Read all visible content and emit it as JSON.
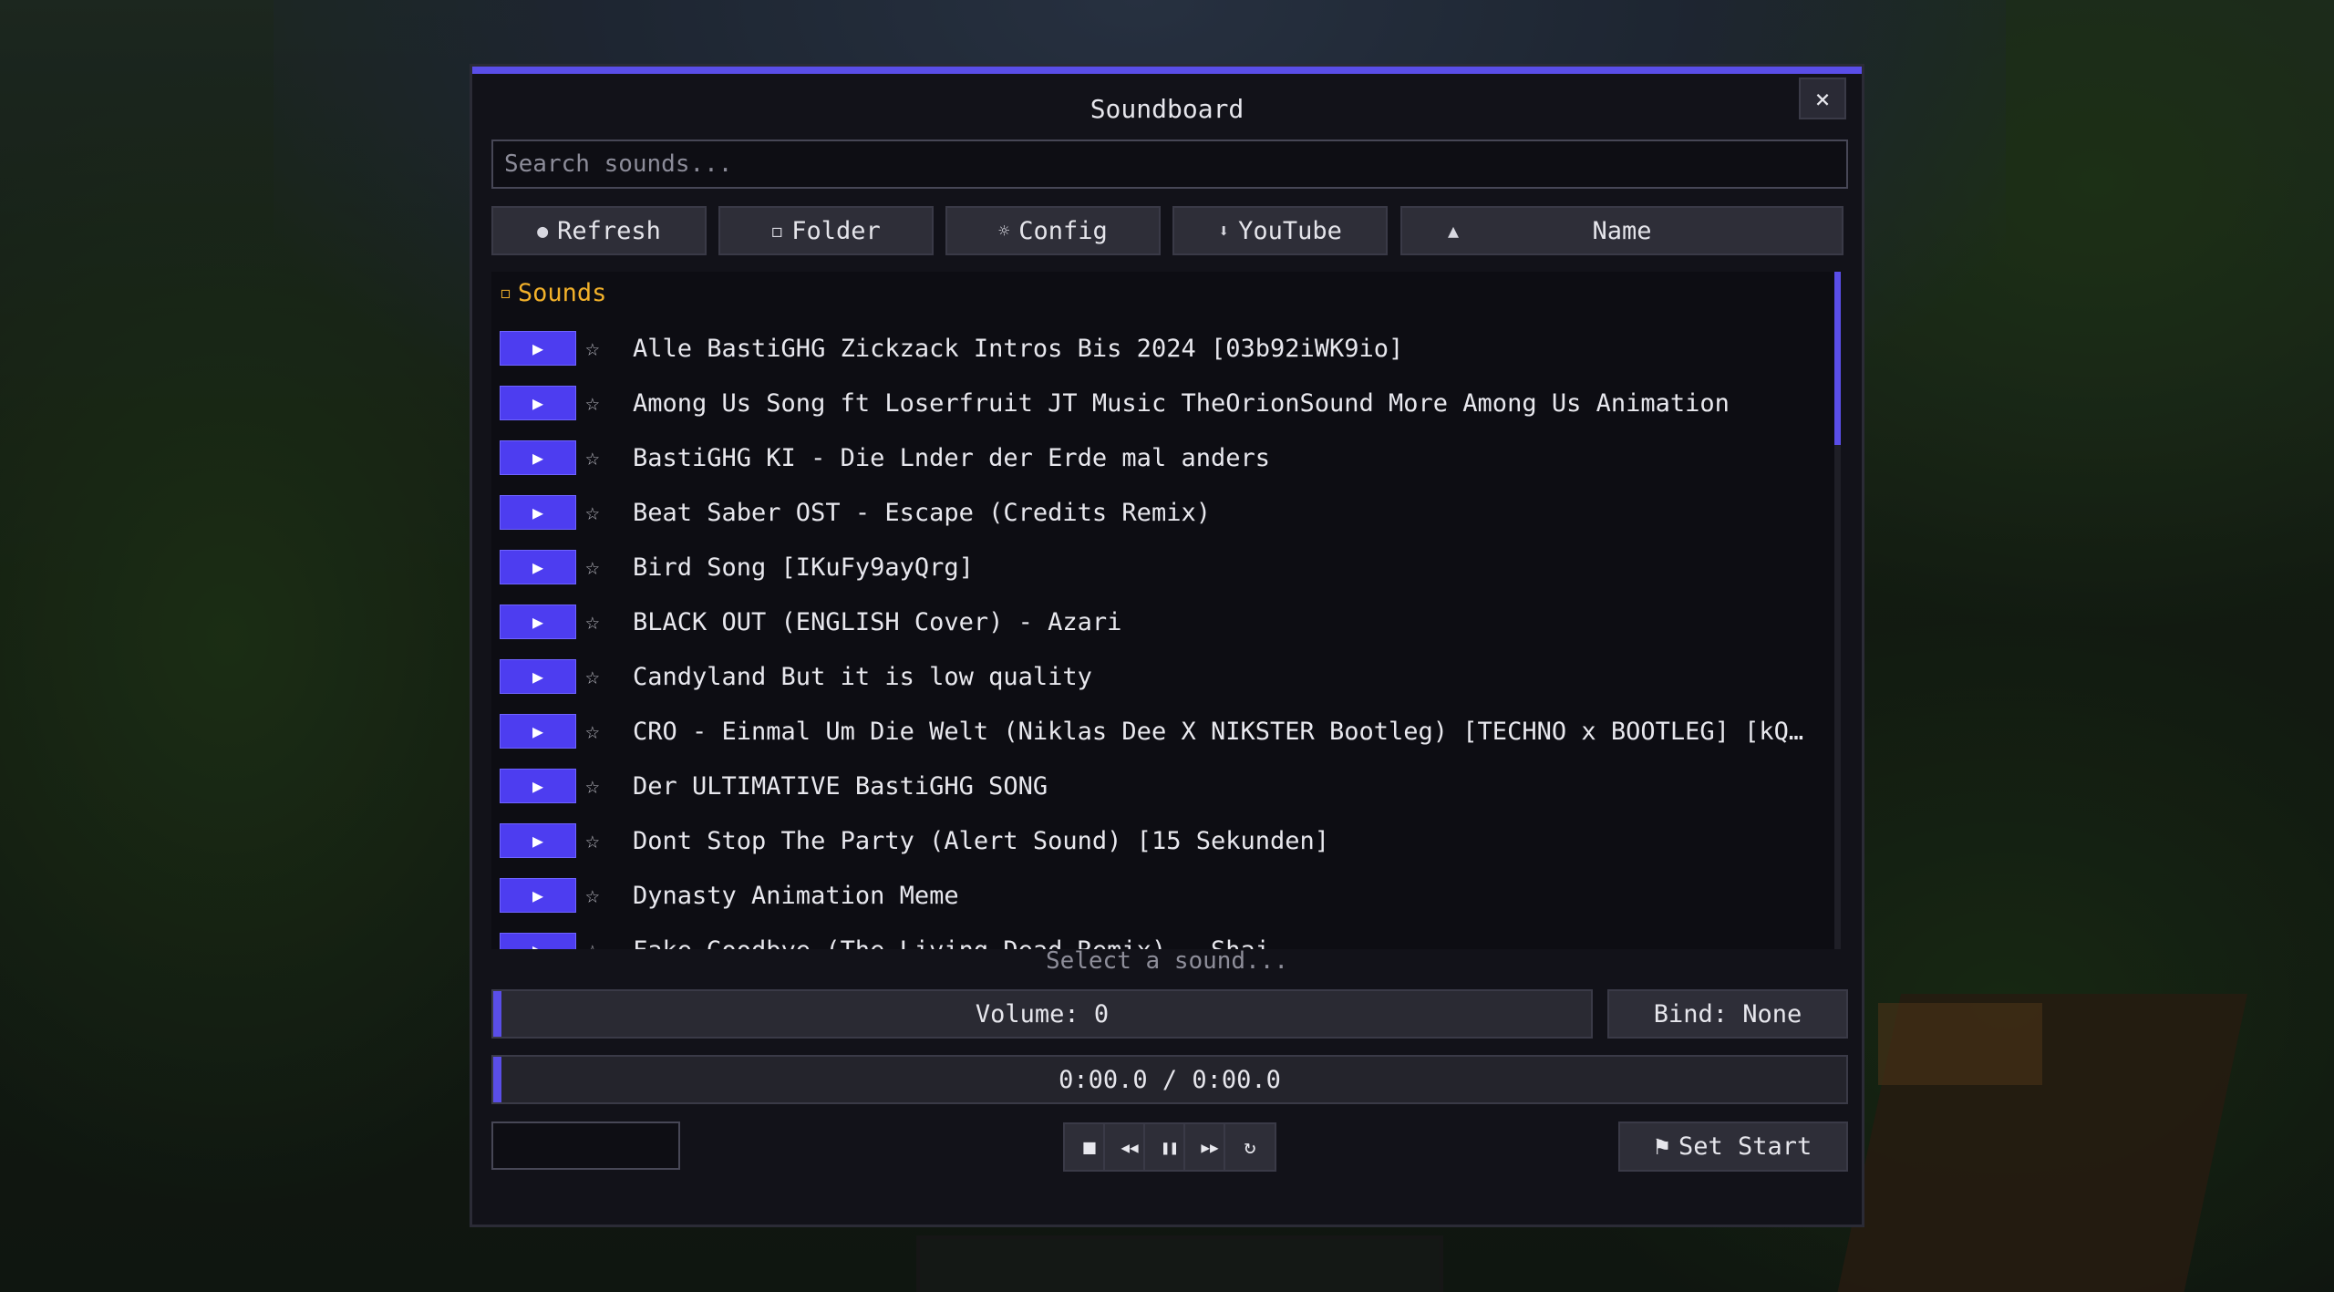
{
  "window": {
    "title": "Soundboard",
    "close_icon": "×"
  },
  "search": {
    "placeholder": "Search sounds..."
  },
  "toolbar": {
    "refresh": {
      "icon": "●",
      "label": "Refresh"
    },
    "folder": {
      "icon": "◻",
      "label": "Folder"
    },
    "config": {
      "icon": "☼",
      "label": "Config"
    },
    "youtube": {
      "icon": "⬇",
      "label": "YouTube"
    },
    "sort": {
      "icon": "▲",
      "label": "Name"
    }
  },
  "list": {
    "folder_label": "Sounds",
    "folder_icon": "◻",
    "play_icon": "▶",
    "star_icon": "☆",
    "items": [
      "Alle BastiGHG Zickzack Intros Bis 2024 [03b92iWK9io]",
      "Among Us Song ft Loserfruit JT Music TheOrionSound More Among Us Animation",
      "BastiGHG KI - Die Lnder der Erde mal anders",
      "Beat Saber OST - Escape (Credits Remix)",
      "Bird Song [IKuFy9ayQrg]",
      "BLACK OUT (ENGLISH Cover) - Azari",
      "Candyland But it is low quality",
      "CRO - Einmal Um Die Welt (Niklas Dee X NIKSTER Bootleg) [TECHNO x BOOTLEG] [kQdJrLV...",
      "Der ULTIMATIVE BastiGHG SONG",
      "Dont Stop The Party (Alert Sound) [15 Sekunden]",
      "Dynasty Animation Meme",
      "Fake Goodbye (The Living Dead Remix) - Shai"
    ]
  },
  "status": "Select a sound...",
  "volume": {
    "label": "Volume: 0",
    "level": 0
  },
  "bind": {
    "label": "Bind: None"
  },
  "timeline": {
    "label": "0:00.0 / 0:00.0",
    "progress": 0
  },
  "controls": {
    "stop": "■",
    "rewind": "◀◀",
    "pause": "❚❚",
    "forward": "▶▶",
    "loop": "↻"
  },
  "set_start": {
    "icon": "⚑",
    "label": "Set Start"
  },
  "colors": {
    "accent": "#5a4ee8",
    "play_button": "#4d3df0",
    "folder": "#f2b12a",
    "panel": "#121219"
  }
}
